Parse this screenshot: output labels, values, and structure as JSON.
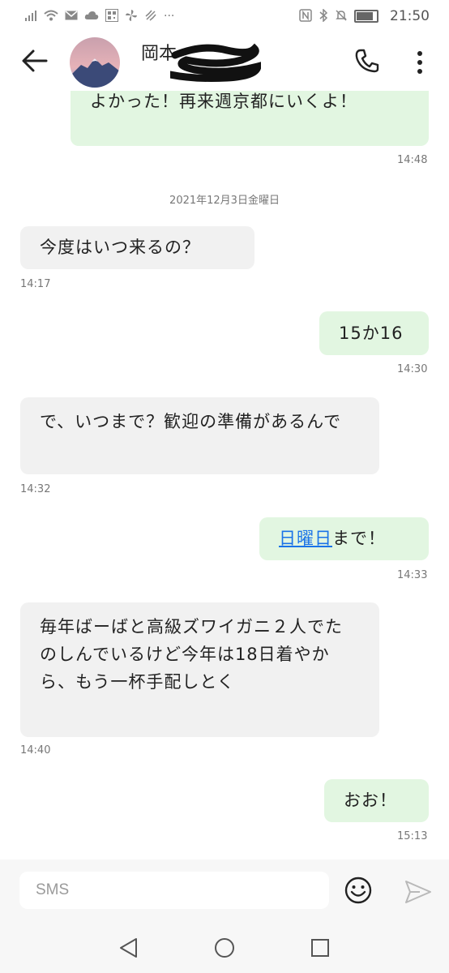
{
  "status_bar": {
    "time": "21:50",
    "more": "···"
  },
  "header": {
    "contact_name": "岡本"
  },
  "messages": [
    {
      "direction": "out",
      "text": "よかった！再来週京都にいくよ！",
      "time": "14:48"
    },
    {
      "direction": "in",
      "text": "今度はいつ来るの？",
      "time": "14:17"
    },
    {
      "direction": "out",
      "text": "15か16",
      "time": "14:30"
    },
    {
      "direction": "in",
      "text": "で、いつまで？歓迎の準備があるんで",
      "time": "14:32"
    },
    {
      "direction": "out",
      "link_text": "日曜日",
      "text": "まで！",
      "time": "14:33"
    },
    {
      "direction": "in",
      "text": "毎年ばーばと高級ズワイガニ２人でたのしんでいるけど今年は18日着やから、もう一杯手配しとく",
      "time": "14:40"
    },
    {
      "direction": "out",
      "text": "おお！",
      "time": "15:13"
    }
  ],
  "date_separator": "2021年12月3日金曜日",
  "input": {
    "placeholder": "SMS"
  }
}
